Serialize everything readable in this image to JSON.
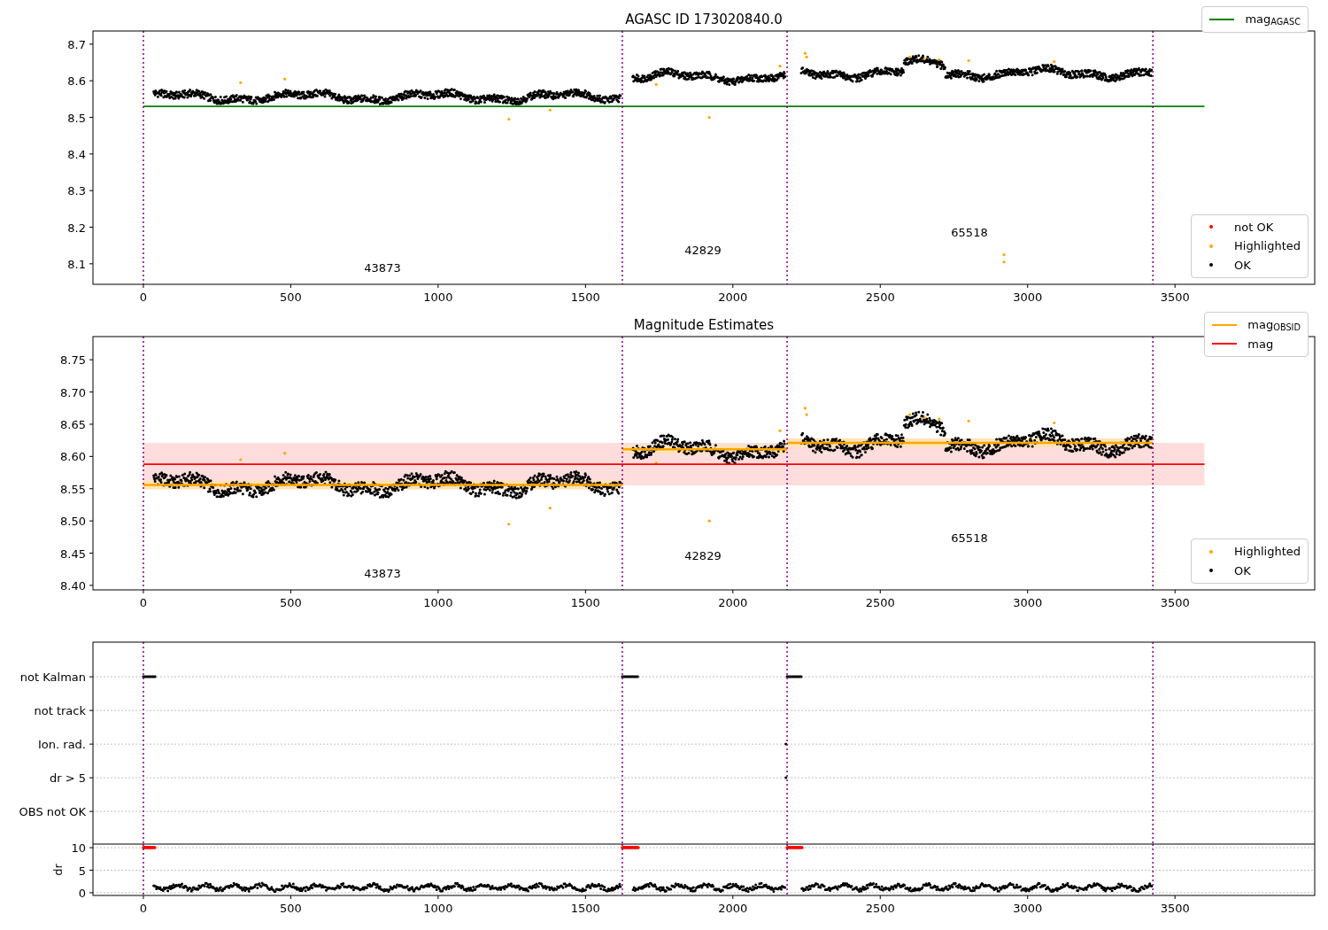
{
  "panels": [
    {
      "kind": "agasc",
      "chart_data": {
        "type": "scatter",
        "title": "AGASC ID 173020840.0",
        "xlim": [
          -171,
          3974
        ],
        "ylim": [
          8.044,
          8.736
        ],
        "xticks": [
          0,
          500,
          1000,
          1500,
          2000,
          2500,
          3000,
          3500
        ],
        "yticks": [
          {
            "value": 8.1,
            "label": "8.1"
          },
          {
            "value": 8.2,
            "label": "8.2"
          },
          {
            "value": 8.3,
            "label": "8.3"
          },
          {
            "value": 8.4,
            "label": "8.4"
          },
          {
            "value": 8.5,
            "label": "8.5"
          },
          {
            "value": 8.6,
            "label": "8.6"
          },
          {
            "value": 8.7,
            "label": "8.7"
          }
        ],
        "series": [
          {
            "name": "mag$_{AGASC}$",
            "type": "line",
            "color": "#008000",
            "x": [
              0,
              3600
            ],
            "values": [
              8.53,
              8.53
            ]
          }
        ],
        "ref_lines": [
          {
            "axis": "x",
            "value": 0,
            "color": "#800080"
          },
          {
            "axis": "x",
            "value": 1625,
            "color": "#800080"
          },
          {
            "axis": "x",
            "value": 2184,
            "color": "#800080"
          },
          {
            "axis": "x",
            "value": 3425,
            "color": "#800080"
          }
        ],
        "annotations": [
          "43873",
          "42829",
          "65518"
        ],
        "legend": true
      },
      "point_classes": [
        {
          "label": "not OK",
          "color": "#ff0000"
        },
        {
          "label": "Highlighted",
          "color": "#ffa500"
        },
        {
          "label": "OK",
          "color": "#000000"
        }
      ]
    },
    {
      "kind": "estimates",
      "chart_data": {
        "type": "scatter",
        "title": "Magnitude Estimates",
        "xlim": [
          -171,
          3974
        ],
        "ylim": [
          8.393,
          8.786
        ],
        "xticks": [
          0,
          500,
          1000,
          1500,
          2000,
          2500,
          3000,
          3500
        ],
        "yticks": [
          {
            "value": 8.4,
            "label": "8.40"
          },
          {
            "value": 8.45,
            "label": "8.45"
          },
          {
            "value": 8.5,
            "label": "8.50"
          },
          {
            "value": 8.55,
            "label": "8.55"
          },
          {
            "value": 8.6,
            "label": "8.60"
          },
          {
            "value": 8.65,
            "label": "8.65"
          },
          {
            "value": 8.7,
            "label": "8.70"
          },
          {
            "value": 8.75,
            "label": "8.75"
          }
        ],
        "series": [
          {
            "name": "mag$_{OBSID}$",
            "type": "line",
            "color": "#ffa500",
            "x": [
              0,
              1625,
              null,
              1625,
              2184,
              null,
              2184,
              3425
            ],
            "values": [
              8.556,
              8.556,
              null,
              8.611,
              8.611,
              null,
              8.621,
              8.621
            ]
          },
          {
            "name": "mag",
            "type": "line",
            "color": "#ff0000",
            "x": [
              0,
              3600
            ],
            "values": [
              8.588,
              8.588
            ]
          }
        ],
        "ref_lines": [
          {
            "axis": "x",
            "value": 0,
            "color": "#800080"
          },
          {
            "axis": "x",
            "value": 1625,
            "color": "#800080"
          },
          {
            "axis": "x",
            "value": 2184,
            "color": "#800080"
          },
          {
            "axis": "x",
            "value": 3425,
            "color": "#800080"
          }
        ],
        "bands": [
          {
            "axis": "y",
            "from": 8.555,
            "to": 8.621,
            "color": "#ffdddd"
          },
          {
            "axis": "y",
            "from": 8.549,
            "to": 8.563,
            "color": "#ffe3b8"
          },
          {
            "axis": "y",
            "from": 8.604,
            "to": 8.618,
            "color": "#ffe3b8"
          },
          {
            "axis": "y",
            "from": 8.614,
            "to": 8.628,
            "color": "#ffe3b8"
          }
        ],
        "annotations": [
          "43873",
          "42829",
          "65518"
        ],
        "legend": true
      },
      "point_classes": [
        {
          "label": "Highlighted",
          "color": "#ffa500"
        },
        {
          "label": "OK",
          "color": "#000000"
        }
      ]
    },
    {
      "kind": "flags",
      "row_labels": [
        "not Kalman",
        "not track",
        "Ion. rad.",
        "dr > 5",
        "OBS not OK"
      ]
    },
    {
      "kind": "dr",
      "chart_data": {
        "type": "scatter",
        "grid": true,
        "ylabel": "dr",
        "xlim": [
          -171,
          3974
        ],
        "ylim": [
          -0.6,
          10.8
        ],
        "xticks": [
          0,
          500,
          1000,
          1500,
          2000,
          2500,
          3000,
          3500
        ],
        "yticks": [
          0,
          5,
          10
        ],
        "ref_lines": [
          {
            "axis": "x",
            "value": 0,
            "color": "#800080"
          },
          {
            "axis": "x",
            "value": 1625,
            "color": "#800080"
          },
          {
            "axis": "x",
            "value": 2184,
            "color": "#800080"
          },
          {
            "axis": "x",
            "value": 3425,
            "color": "#800080"
          }
        ]
      }
    }
  ]
}
